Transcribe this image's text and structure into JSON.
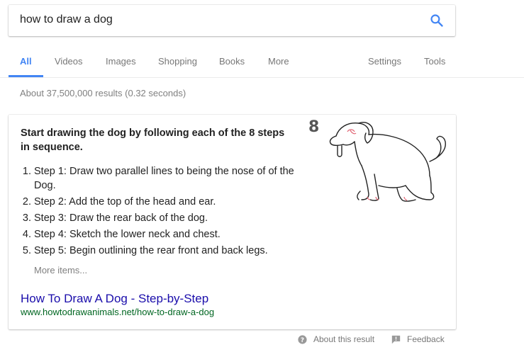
{
  "search": {
    "query": "how to draw a dog"
  },
  "tabs": [
    {
      "label": "All",
      "active": true
    },
    {
      "label": "Videos"
    },
    {
      "label": "Images"
    },
    {
      "label": "Shopping"
    },
    {
      "label": "Books"
    },
    {
      "label": "More"
    },
    {
      "label": "Settings"
    },
    {
      "label": "Tools"
    }
  ],
  "result_stats": "About 37,500,000 results (0.32 seconds)",
  "snippet": {
    "heading": "Start drawing the dog by following each of the 8 steps in sequence.",
    "steps": [
      "Step 1: Draw two parallel lines to being the nose of of the Dog.",
      "Step 2: Add the top of the head and ear.",
      "Step 3: Draw the rear back of the dog.",
      "Step 4: Sketch the lower neck and chest.",
      "Step 5: Begin outlining the rear front and back legs."
    ],
    "more_items": "More items...",
    "title": "How To Draw A Dog - Step-by-Step",
    "url": "www.howtodrawanimals.net/how-to-draw-a-dog",
    "image_step_number": "8"
  },
  "footer": {
    "about": "About this result",
    "feedback": "Feedback"
  },
  "colors": {
    "accent_blue": "#4285f4",
    "link": "#1a0dab",
    "url_green": "#006621"
  }
}
